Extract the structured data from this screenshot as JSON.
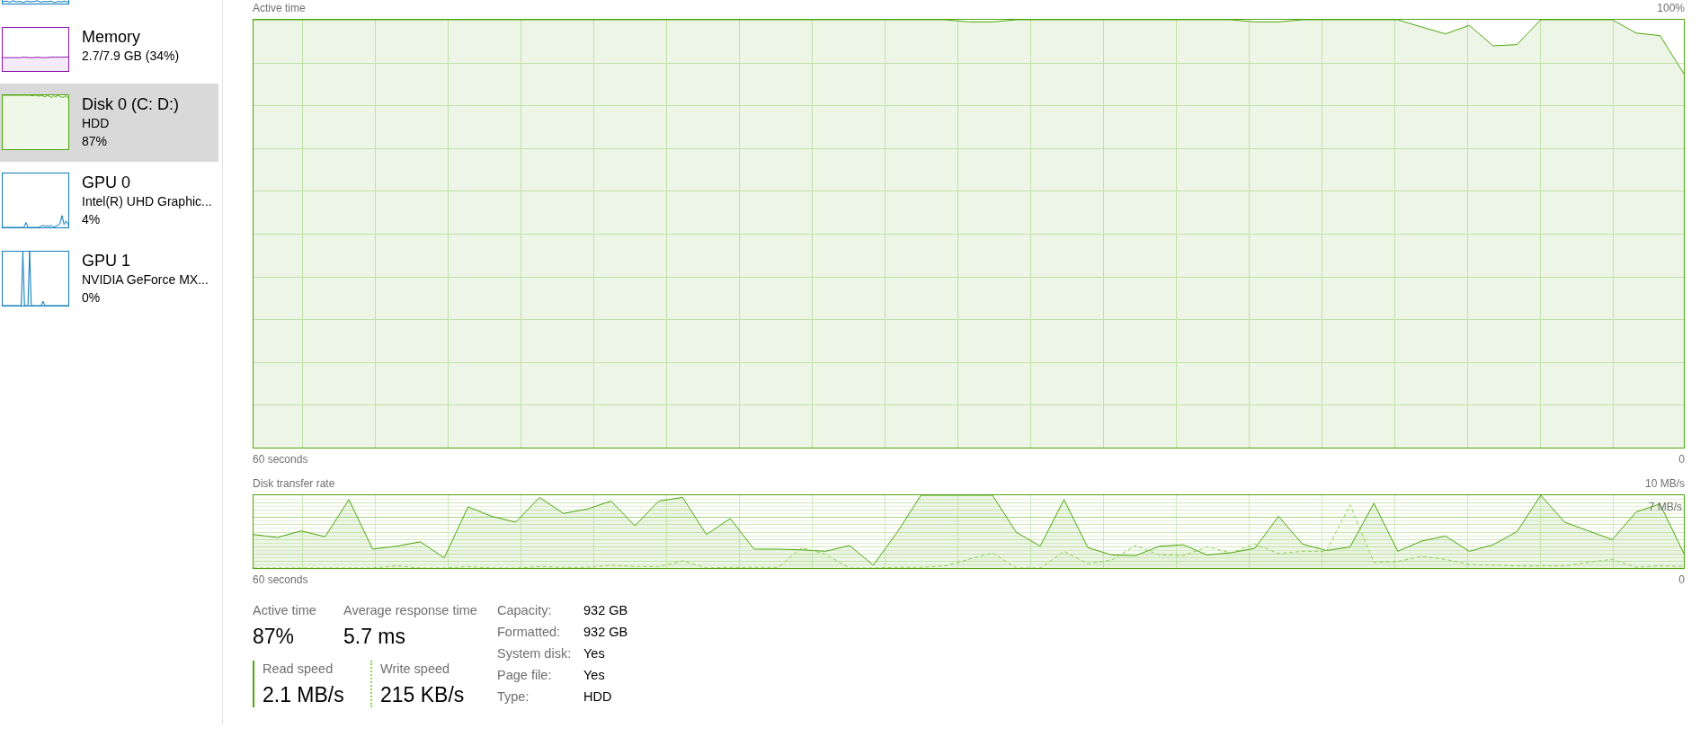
{
  "sidebar": {
    "items": [
      {
        "color": "#117dbb",
        "selected": false
      },
      {
        "title": "Memory",
        "details": [
          "2.7/7.9 GB (34%)"
        ],
        "color": "#8b12ae",
        "selected": false
      },
      {
        "title": "Disk 0 (C: D:)",
        "details": [
          "HDD",
          "87%"
        ],
        "color": "#4da60c",
        "selected": true
      },
      {
        "title": "GPU 0",
        "details": [
          "Intel(R) UHD Graphic...",
          "4%"
        ],
        "color": "#117dbb",
        "selected": false
      },
      {
        "title": "GPU 1",
        "details": [
          "NVIDIA GeForce MX...",
          "0%"
        ],
        "color": "#117dbb",
        "selected": false
      }
    ]
  },
  "active_time_graph": {
    "title": "Active time",
    "scale_label": "100%",
    "start_label": "60 seconds",
    "end_label": "0"
  },
  "transfer_rate_graph": {
    "title": "Disk transfer rate",
    "scale_label": "10 MB/s",
    "marker_label": "7 MB/s",
    "start_label": "60 seconds",
    "end_label": "0"
  },
  "stats": {
    "primary": [
      {
        "label": "Active time",
        "value": "87%"
      },
      {
        "label": "Average response time",
        "value": "5.7 ms"
      }
    ],
    "speeds": [
      {
        "label": "Read speed",
        "value": "2.1 MB/s",
        "color": "#4da60c",
        "dashed": false
      },
      {
        "label": "Write speed",
        "value": "215 KB/s",
        "color": "#8fd14f",
        "dashed": true
      }
    ],
    "properties": [
      {
        "label": "Capacity:",
        "value": "932 GB"
      },
      {
        "label": "Formatted:",
        "value": "932 GB"
      },
      {
        "label": "System disk:",
        "value": "Yes"
      },
      {
        "label": "Page file:",
        "value": "Yes"
      },
      {
        "label": "Type:",
        "value": "HDD"
      }
    ]
  }
}
